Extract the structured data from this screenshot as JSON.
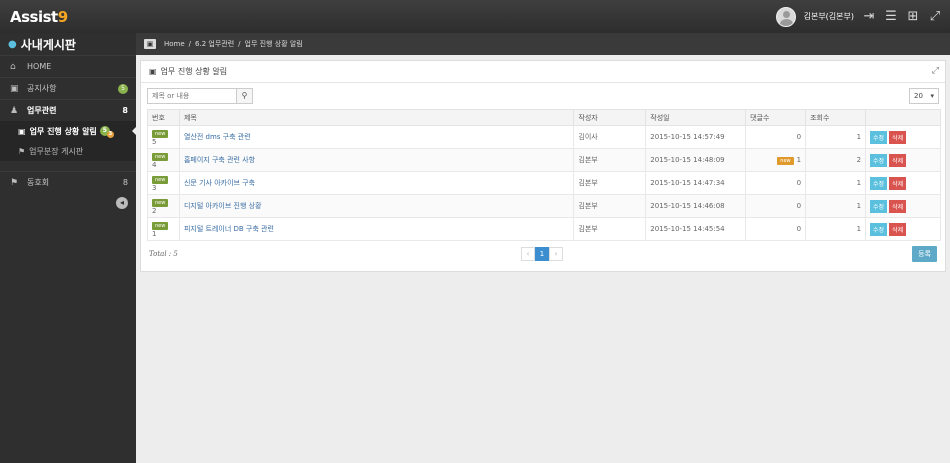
{
  "app": {
    "logo_main": "Assist",
    "logo_accent": "9"
  },
  "topbar": {
    "user_name": "김본부(김본부)",
    "icons": [
      "logout-icon",
      "menu-icon",
      "grid-icon",
      "fullscreen-icon"
    ]
  },
  "sidebar": {
    "title": "사내게시판",
    "items": [
      {
        "label": "HOME",
        "icon": "home-icon"
      },
      {
        "label": "공지사항",
        "icon": "calendar-icon",
        "badge": "5"
      },
      {
        "label": "업무관련",
        "icon": "users-icon",
        "badge": "8"
      }
    ],
    "sub_items": [
      {
        "label": "업무 진행 상황 알림",
        "badge": "5",
        "badge2": "3"
      },
      {
        "label": "업무분장 게시판"
      }
    ],
    "bottom_items": [
      {
        "label": "동호회",
        "icon": "flag-icon",
        "badge": "8"
      }
    ]
  },
  "breadcrumb": {
    "home": "Home",
    "sep": "/",
    "level1": "6.2 업무관련",
    "level2": "업무 진행 상황 알림"
  },
  "panel": {
    "title": "업무 진행 상황 알림",
    "search_placeholder": "제목 or 내용",
    "page_size": "20",
    "columns": [
      "번호",
      "제목",
      "작성자",
      "작성일",
      "댓글수",
      "조회수",
      ""
    ],
    "rows": [
      {
        "no": "5",
        "title": "열산전 dms 구축 관련",
        "author": "김이사",
        "date": "2015-10-15 14:57:49",
        "comments": "0",
        "views": "1",
        "new_comment": false
      },
      {
        "no": "4",
        "title": "홈페이지 구축 관련 사항",
        "author": "김본부",
        "date": "2015-10-15 14:48:09",
        "comments": "1",
        "views": "2",
        "new_comment": true
      },
      {
        "no": "3",
        "title": "신문 기사 아카이브 구축",
        "author": "김본부",
        "date": "2015-10-15 14:47:34",
        "comments": "0",
        "views": "1",
        "new_comment": false
      },
      {
        "no": "2",
        "title": "디지털 아카이브 진행 상황",
        "author": "김본부",
        "date": "2015-10-15 14:46:08",
        "comments": "0",
        "views": "1",
        "new_comment": false
      },
      {
        "no": "1",
        "title": "피지털 트레이너 DB 구축 관련",
        "author": "김본부",
        "date": "2015-10-15 14:45:54",
        "comments": "0",
        "views": "1",
        "new_comment": false
      }
    ],
    "new_label": "new",
    "edit_label": "수정",
    "delete_label": "삭제",
    "total": "Total : 5",
    "pager": {
      "prev": "‹",
      "current": "1",
      "next": "›"
    },
    "register_label": "등록"
  }
}
